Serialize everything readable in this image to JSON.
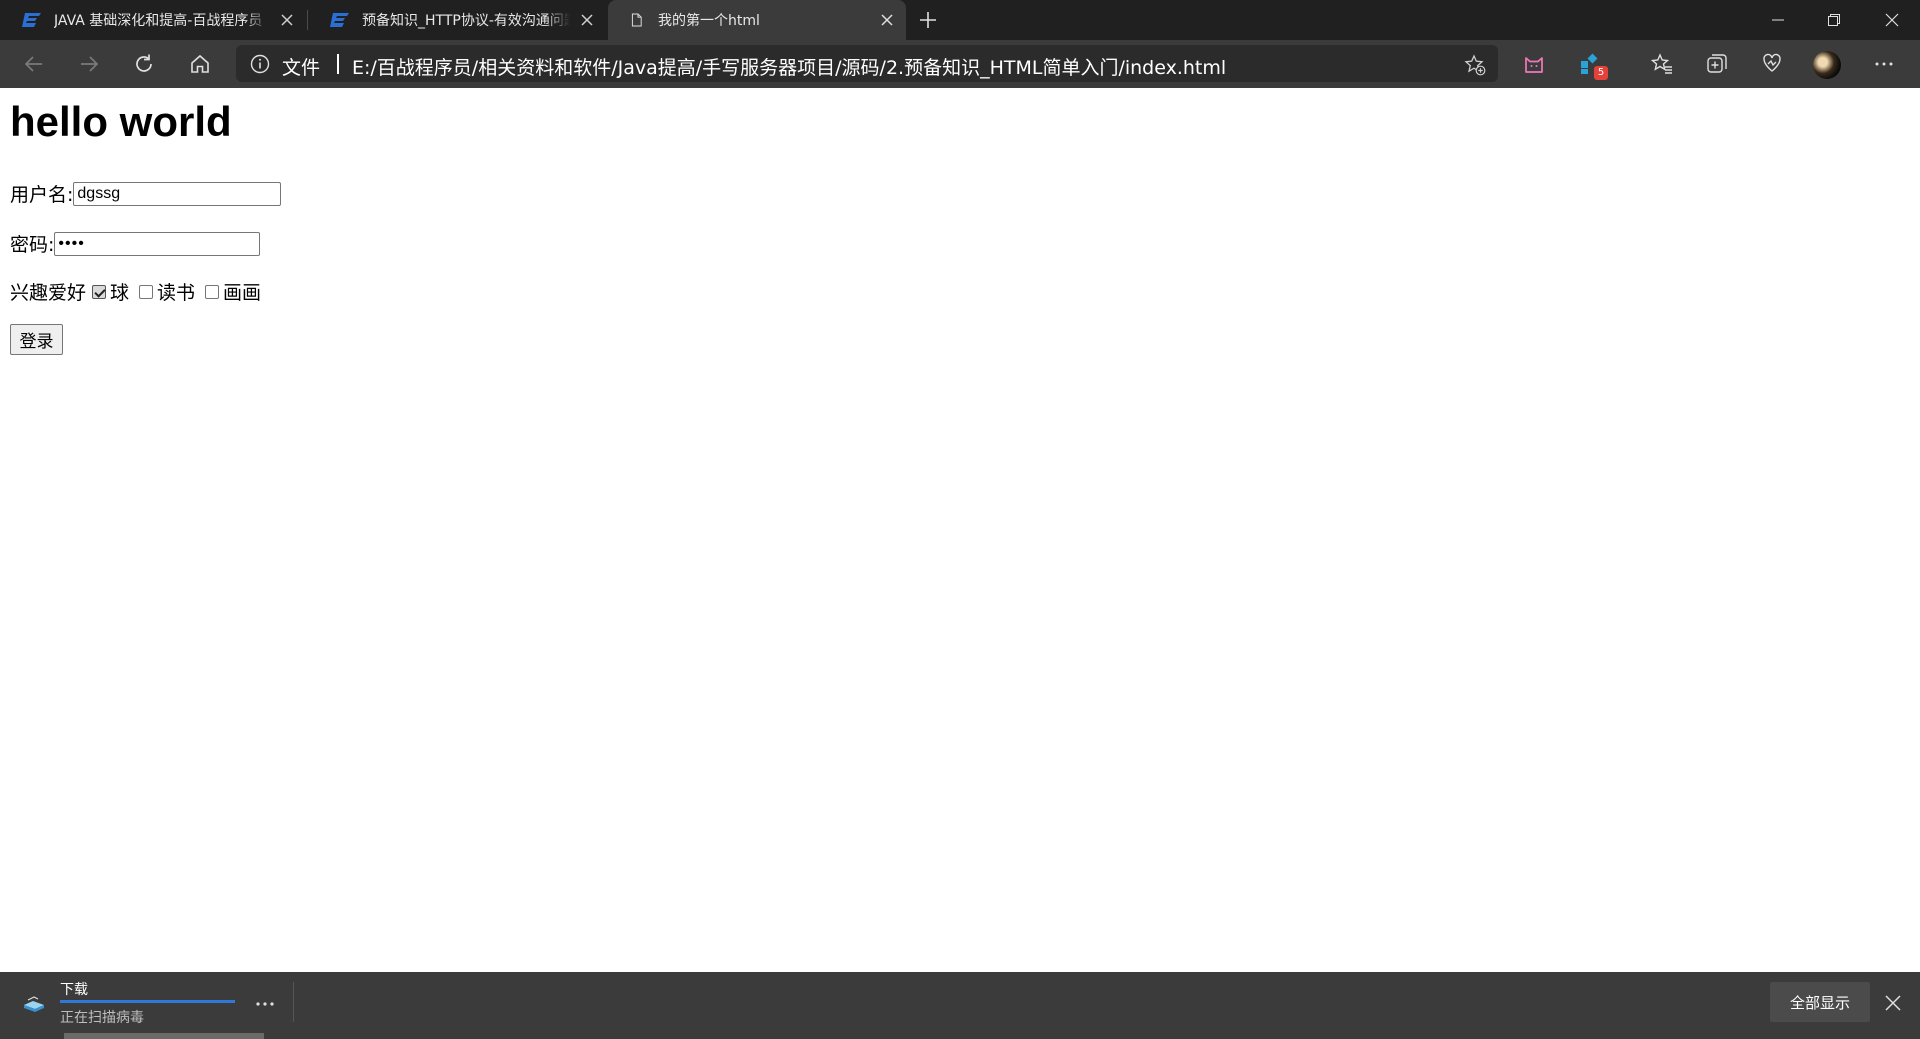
{
  "browser": {
    "tabs": [
      {
        "title": "JAVA 基础深化和提高-百战程序员",
        "favicon": "site-logo-icon",
        "active": false
      },
      {
        "title": "预备知识_HTTP协议-有效沟通问题",
        "favicon": "site-logo-icon",
        "active": false
      },
      {
        "title": "我的第一个html",
        "favicon": "document-icon",
        "active": true
      }
    ],
    "address": {
      "scheme_label": "文件",
      "url": "E:/百战程序员/相关资料和软件/Java提高/手写服务器项目/源码/2.预备知识_HTML简单入门/index.html"
    },
    "extension_badge": "5"
  },
  "page": {
    "heading": "hello world",
    "username_label": "用户名:",
    "username_value": "dgssg",
    "password_label": "密码:",
    "password_value": "••••",
    "hobbies_label": "兴趣爱好",
    "hobbies": [
      {
        "label": "球",
        "checked": true
      },
      {
        "label": "读书",
        "checked": false
      },
      {
        "label": "画画",
        "checked": false
      }
    ],
    "login_button": "登录"
  },
  "download_bar": {
    "title": "下载",
    "status": "正在扫描病毒",
    "show_all": "全部显示"
  },
  "colors": {
    "titlebar": "#202020",
    "toolbar": "#3b3b3b",
    "accent": "#2f78d8",
    "badge": "#e4413a"
  }
}
